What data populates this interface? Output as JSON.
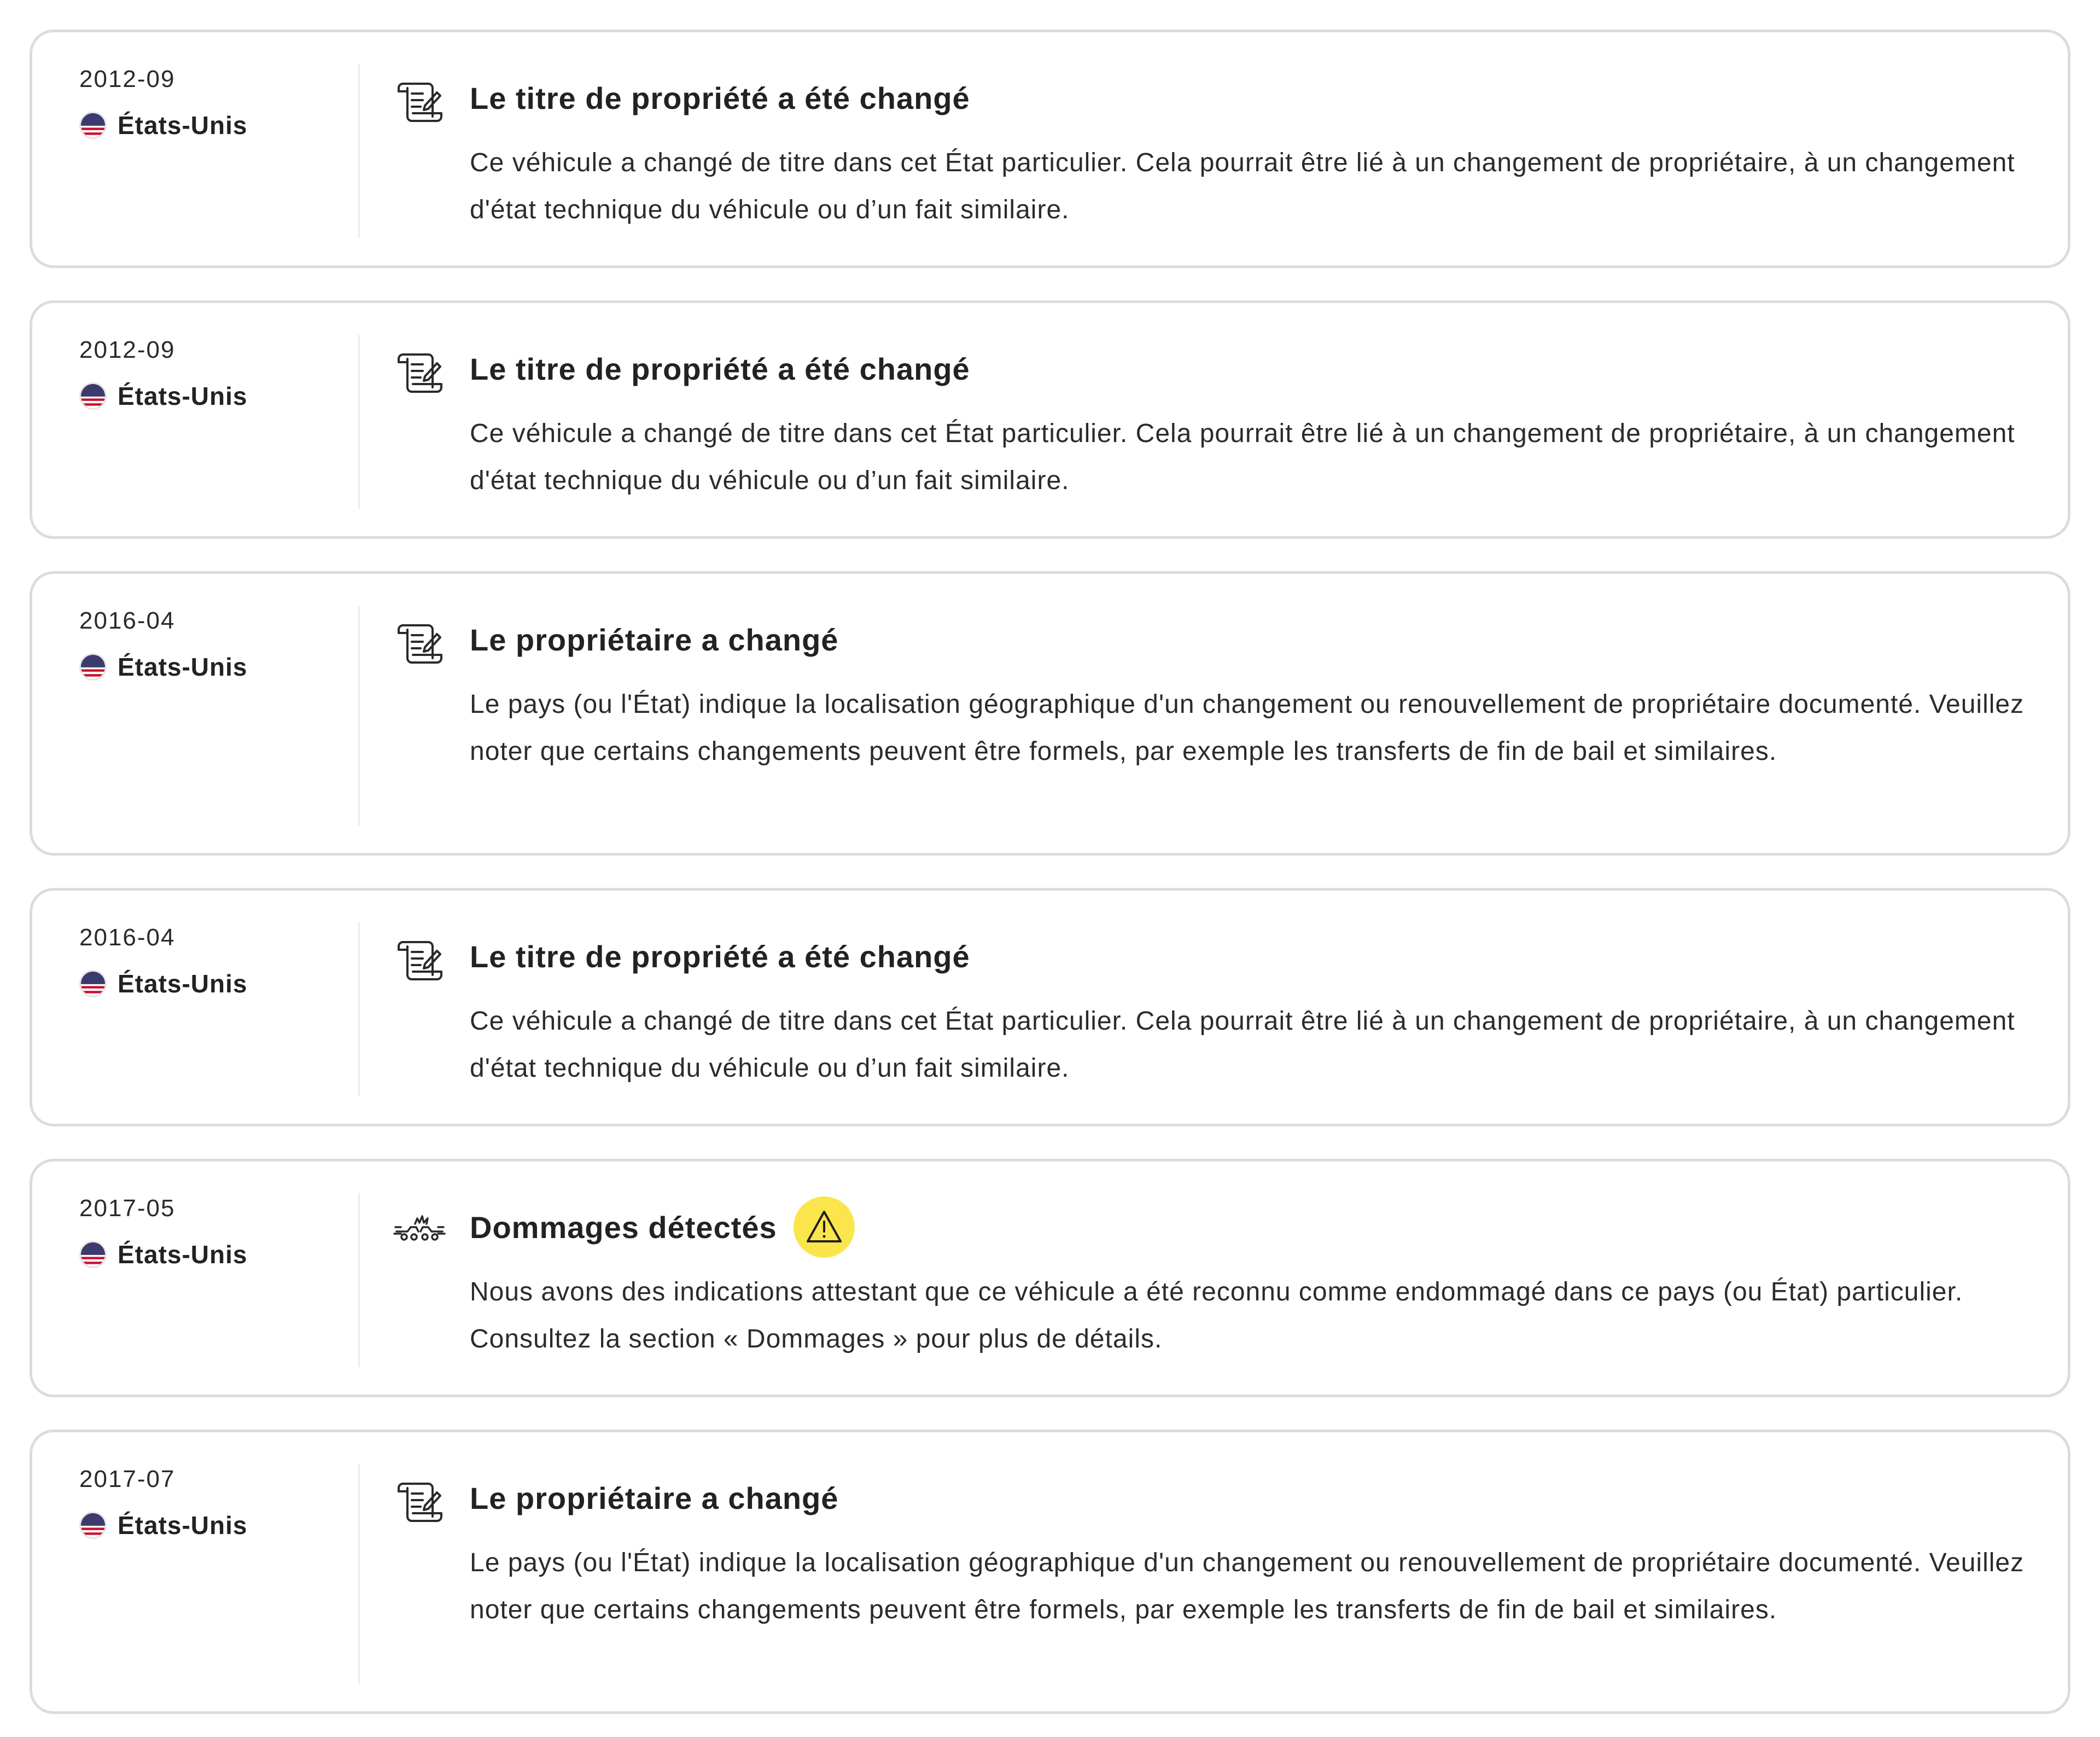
{
  "events": [
    {
      "date": "2012-09",
      "country": "États-Unis",
      "icon": "title-document-icon",
      "title": "Le titre de propriété a été changé",
      "description": "Ce véhicule a changé de titre dans cet État particulier. Cela pourrait être lié à un changement de propriétaire, à un changement d'état technique du véhicule ou d’un fait similaire."
    },
    {
      "date": "2012-09",
      "country": "États-Unis",
      "icon": "title-document-icon",
      "title": "Le titre de propriété a été changé",
      "description": "Ce véhicule a changé de titre dans cet État particulier. Cela pourrait être lié à un changement de propriétaire, à un changement d'état technique du véhicule ou d’un fait similaire."
    },
    {
      "date": "2016-04",
      "country": "États-Unis",
      "icon": "title-document-icon",
      "title": "Le propriétaire a changé",
      "description": "Le pays (ou l'État) indique la localisation géographique d'un changement ou renouvellement de propriétaire documenté. Veuillez noter que certains changements peuvent être formels, par exemple les transferts de fin de bail et similaires."
    },
    {
      "date": "2016-04",
      "country": "États-Unis",
      "icon": "title-document-icon",
      "title": "Le titre de propriété a été changé",
      "description": "Ce véhicule a changé de titre dans cet État particulier. Cela pourrait être lié à un changement de propriétaire, à un changement d'état technique du véhicule ou d’un fait similaire."
    },
    {
      "date": "2017-05",
      "country": "États-Unis",
      "icon": "car-crash-icon",
      "title": "Dommages détectés",
      "warning_icon": "warning-icon",
      "description": "Nous avons des indications attestant que ce véhicule a été reconnu comme endommagé dans ce pays (ou État) particulier. Consultez la section « Dommages » pour plus de détails."
    },
    {
      "date": "2017-07",
      "country": "États-Unis",
      "icon": "title-document-icon",
      "title": "Le propriétaire a changé",
      "description": "Le pays (ou l'État) indique la localisation géographique d'un changement ou renouvellement de propriétaire documenté. Veuillez noter que certains changements peuvent être formels, par exemple les transferts de fin de bail et similaires."
    }
  ],
  "colors": {
    "card_border": "#dcdcdc",
    "warning_bg": "#fbe54c",
    "text": "#222222"
  }
}
